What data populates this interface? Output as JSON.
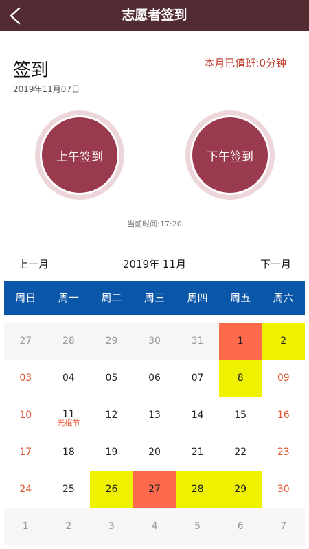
{
  "header": {
    "title": "志愿者签到",
    "back_icon": "chevron-left-icon"
  },
  "signin": {
    "title": "签到",
    "date": "2019年11月07日",
    "month_duty": "本月已值班:0分钟",
    "am_button": "上午签到",
    "pm_button": "下午签到",
    "current_time": "当前时间:17:20"
  },
  "calendar": {
    "prev_label": "上一月",
    "month_label": "2019年 11月",
    "next_label": "下一月",
    "weekdays": [
      "周日",
      "周一",
      "周二",
      "周三",
      "周四",
      "周五",
      "周六"
    ],
    "colors": {
      "header_bg": "#0a56a8",
      "red": "#ff6a4c",
      "yellow": "#eef200",
      "weekend_text": "#e0532e"
    },
    "rows": [
      [
        {
          "day": "27",
          "muted": true
        },
        {
          "day": "28",
          "muted": true
        },
        {
          "day": "29",
          "muted": true
        },
        {
          "day": "30",
          "muted": true
        },
        {
          "day": "31",
          "muted": true
        },
        {
          "day": "1",
          "highlight": "red"
        },
        {
          "day": "2",
          "highlight": "yellow",
          "weekend": true
        }
      ],
      [
        {
          "day": "03",
          "weekend": true
        },
        {
          "day": "04"
        },
        {
          "day": "05"
        },
        {
          "day": "06"
        },
        {
          "day": "07"
        },
        {
          "day": "8",
          "highlight": "yellow"
        },
        {
          "day": "09",
          "weekend": true
        }
      ],
      [
        {
          "day": "10",
          "weekend": true
        },
        {
          "day": "11",
          "note": "光棍节"
        },
        {
          "day": "12"
        },
        {
          "day": "13"
        },
        {
          "day": "14"
        },
        {
          "day": "15"
        },
        {
          "day": "16",
          "weekend": true
        }
      ],
      [
        {
          "day": "17",
          "weekend": true
        },
        {
          "day": "18"
        },
        {
          "day": "19"
        },
        {
          "day": "20"
        },
        {
          "day": "21"
        },
        {
          "day": "22"
        },
        {
          "day": "23",
          "weekend": true
        }
      ],
      [
        {
          "day": "24",
          "weekend": true
        },
        {
          "day": "25"
        },
        {
          "day": "26",
          "highlight": "yellow"
        },
        {
          "day": "27",
          "highlight": "red"
        },
        {
          "day": "28",
          "highlight": "yellow"
        },
        {
          "day": "29",
          "highlight": "yellow"
        },
        {
          "day": "30",
          "weekend": true
        }
      ],
      [
        {
          "day": "1",
          "muted": true
        },
        {
          "day": "2",
          "muted": true
        },
        {
          "day": "3",
          "muted": true
        },
        {
          "day": "4",
          "muted": true
        },
        {
          "day": "5",
          "muted": true
        },
        {
          "day": "6",
          "muted": true
        },
        {
          "day": "7",
          "muted": true
        }
      ]
    ]
  }
}
